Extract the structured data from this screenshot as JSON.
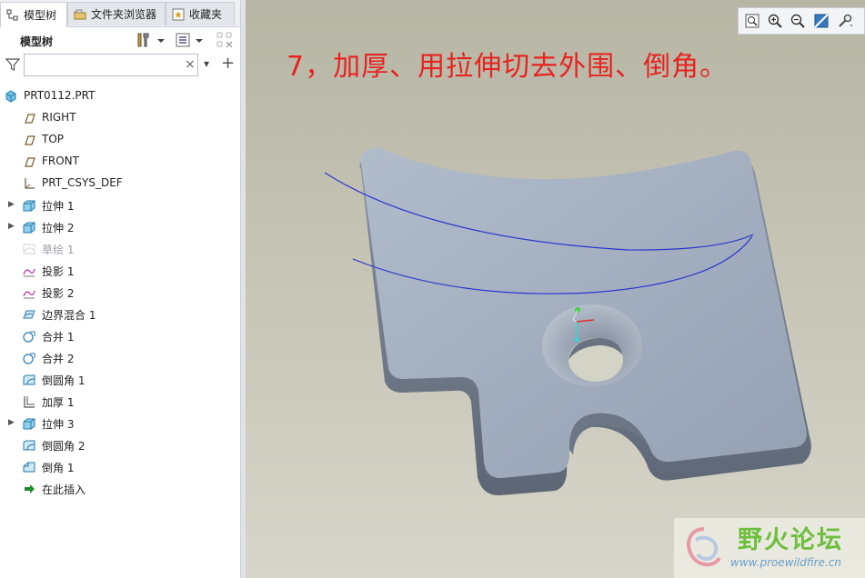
{
  "tabs": [
    {
      "label": "模型树",
      "icon": "model-tree-icon"
    },
    {
      "label": "文件夹浏览器",
      "icon": "folder-browser-icon"
    },
    {
      "label": "收藏夹",
      "icon": "favorites-icon"
    }
  ],
  "panel_header": {
    "title": "模型树"
  },
  "filter": {
    "search_value": "",
    "clear_glyph": "×",
    "dropdown_glyph": "▾",
    "add_glyph": "+"
  },
  "tree": {
    "root": "PRT0112.PRT",
    "items": [
      {
        "label": "RIGHT",
        "icon": "datum-plane-icon",
        "expandable": false
      },
      {
        "label": "TOP",
        "icon": "datum-plane-icon",
        "expandable": false
      },
      {
        "label": "FRONT",
        "icon": "datum-plane-icon",
        "expandable": false
      },
      {
        "label": "PRT_CSYS_DEF",
        "icon": "coordinate-system-icon",
        "expandable": false
      },
      {
        "label": "拉伸 1",
        "icon": "extrude-icon",
        "expandable": true
      },
      {
        "label": "拉伸 2",
        "icon": "extrude-icon",
        "expandable": true
      },
      {
        "label": "草绘 1",
        "icon": "sketch-icon",
        "expandable": false,
        "dimmed": true
      },
      {
        "label": "投影 1",
        "icon": "projection-icon",
        "expandable": false
      },
      {
        "label": "投影 2",
        "icon": "projection-icon",
        "expandable": false
      },
      {
        "label": "边界混合 1",
        "icon": "boundary-blend-icon",
        "expandable": false
      },
      {
        "label": "合并 1",
        "icon": "merge-icon",
        "expandable": false
      },
      {
        "label": "合并 2",
        "icon": "merge-icon",
        "expandable": false
      },
      {
        "label": "倒圆角 1",
        "icon": "round-icon",
        "expandable": false
      },
      {
        "label": "加厚 1",
        "icon": "thicken-icon",
        "expandable": false
      },
      {
        "label": "拉伸 3",
        "icon": "extrude-icon",
        "expandable": true
      },
      {
        "label": "倒圆角 2",
        "icon": "round-icon",
        "expandable": false
      },
      {
        "label": "倒角 1",
        "icon": "chamfer-icon",
        "expandable": false
      },
      {
        "label": "在此插入",
        "icon": "insert-here-arrow-icon",
        "expandable": false
      }
    ]
  },
  "viewport": {
    "caption": "7，加厚、用拉伸切去外围、倒角。",
    "caption_color": "#e8221e",
    "view_tools": [
      "refit-icon",
      "zoom-in-icon",
      "zoom-out-icon",
      "repaint-icon",
      "more-tools-icon"
    ]
  },
  "watermark": {
    "brand": "野火论坛",
    "url": "www.proewildfire.cn"
  },
  "colors": {
    "accent": "#e8221e",
    "part_face": "#a3afc0",
    "part_side": "#7d8798",
    "curve": "#2a35d0",
    "background": "#c5c4b5"
  }
}
